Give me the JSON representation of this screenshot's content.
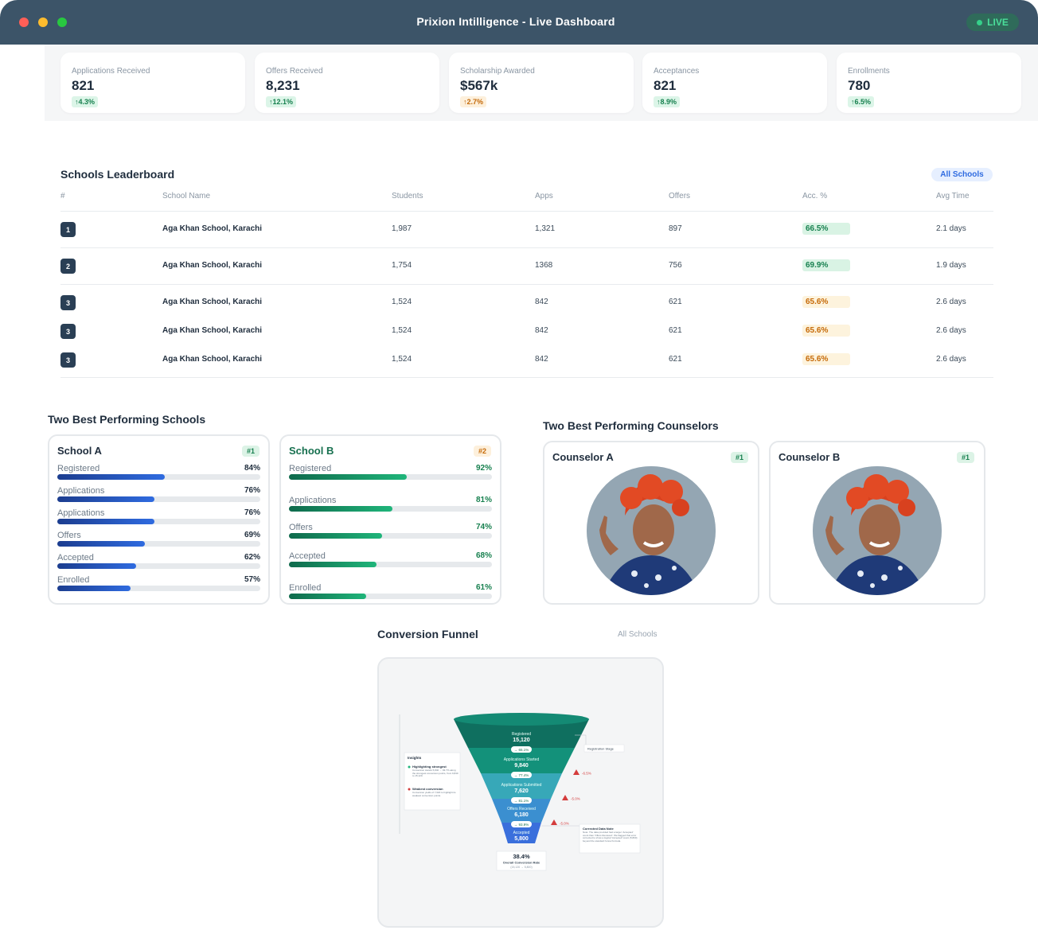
{
  "window": {
    "title": "Prixion Intilligence - Live Dashboard",
    "live_label": "LIVE"
  },
  "kpis": [
    {
      "label": "Applications Received",
      "value": "821",
      "change": "↑4.3%",
      "tone": "up"
    },
    {
      "label": "Offers Received",
      "value": "8,231",
      "change": "↑12.1%",
      "tone": "up"
    },
    {
      "label": "Scholarship Awarded",
      "value": "$567k",
      "change": "↑2.7%",
      "tone": "warn"
    },
    {
      "label": "Acceptances",
      "value": "821",
      "change": "↑8.9%",
      "tone": "up"
    },
    {
      "label": "Enrollments",
      "value": "780",
      "change": "↑6.5%",
      "tone": "up"
    }
  ],
  "leaderboard": {
    "title": "Schools Leaderboard",
    "filter_label": "All Schools",
    "columns": [
      "#",
      "School Name",
      "Students",
      "Apps",
      "Offers",
      "Acc. %",
      "Avg Time"
    ],
    "rows": [
      {
        "rank": "1",
        "name": "Aga Khan School, Karachi",
        "students": "1,987",
        "apps": "1,321",
        "offers": "897",
        "acc": "66.5%",
        "acc_tone": "good",
        "time": "2.1 days"
      },
      {
        "rank": "2",
        "name": "Aga Khan School, Karachi",
        "students": "1,754",
        "apps": "1368",
        "offers": "756",
        "acc": "69.9%",
        "acc_tone": "good",
        "time": "1.9 days"
      },
      {
        "rank": "3",
        "name": "Aga Khan School, Karachi",
        "students": "1,524",
        "apps": "842",
        "offers": "621",
        "acc": "65.6%",
        "acc_tone": "mid",
        "time": "2.6 days"
      },
      {
        "rank": "3",
        "name": "Aga Khan School, Karachi",
        "students": "1,524",
        "apps": "842",
        "offers": "621",
        "acc": "65.6%",
        "acc_tone": "mid",
        "time": "2.6 days"
      },
      {
        "rank": "3",
        "name": "Aga Khan School, Karachi",
        "students": "1,524",
        "apps": "842",
        "offers": "621",
        "acc": "65.6%",
        "acc_tone": "mid",
        "time": "2.6 days"
      }
    ]
  },
  "best_schools": {
    "title": "Two Best Performing Schools",
    "cards": [
      {
        "name": "School A",
        "badge": "#1",
        "metrics": [
          {
            "label": "Registered",
            "value": "84%",
            "fraction": 0.53
          },
          {
            "label": "Applications",
            "value": "76%",
            "fraction": 0.48
          },
          {
            "label": "Applications",
            "value": "76%",
            "fraction": 0.48
          },
          {
            "label": "Offers",
            "value": "69%",
            "fraction": 0.43
          },
          {
            "label": "Accepted",
            "value": "62%",
            "fraction": 0.39
          },
          {
            "label": "Enrolled",
            "value": "57%",
            "fraction": 0.36
          }
        ]
      },
      {
        "name": "School B",
        "badge": "#2",
        "metrics": [
          {
            "label": "Registered",
            "value": "92%",
            "fraction": 0.58
          },
          {
            "label": "Applications",
            "value": "81%",
            "fraction": 0.51
          },
          {
            "label": "Offers",
            "value": "74%",
            "fraction": 0.46
          },
          {
            "label": "Accepted",
            "value": "68%",
            "fraction": 0.43
          },
          {
            "label": "Enrolled",
            "value": "61%",
            "fraction": 0.38
          }
        ]
      }
    ]
  },
  "best_counselors": {
    "title": "Two Best Performing Counselors",
    "cards": [
      {
        "name": "Counselor A",
        "badge": "#1"
      },
      {
        "name": "Counselor B",
        "badge": "#1"
      }
    ]
  },
  "funnel": {
    "title": "Conversion Funnel",
    "filter_label": "All Schools",
    "stages": [
      {
        "label": "Registered",
        "value": "15,120"
      },
      {
        "label": "Applications Started",
        "value": "9,840"
      },
      {
        "label": "Applications Submitted",
        "value": "7,620"
      },
      {
        "label": "Offers Received",
        "value": "6,180"
      },
      {
        "label": "Accepted",
        "value": "5,800"
      }
    ],
    "rates": [
      "→ 65.1%",
      "→ 77.4%",
      "→ 81.1%",
      "→ 93.9%"
    ],
    "drops": [
      "-6.5%",
      "-5.0%",
      "-5.0%"
    ],
    "stage_note": "Registration Stage",
    "overall": {
      "value": "38.4%",
      "label": "Overall Conversion Rate",
      "sub": "(15,120 → 5,800)"
    },
    "insights": {
      "title": "Insights",
      "strong_title": "Highlighting strongest",
      "strong_text": "Conversion stands 5,840 → 93.7% along the strongest conversion points, from 9,840 to 15,120.",
      "weak_title": "Weakest conversion",
      "weak_text": "Conversion yields of 7,620 to highlight its weakest conversion points."
    },
    "note": {
      "title": "Corrected Data Note",
      "text": "Note: The data provided had a larger 'Accepted' count than 'Offers Received'. We flagged that error corrected to show a logical 'Accepted' count (5,800) beyond the standard funnel formula."
    }
  },
  "colors": {
    "titlebar": "#3c5468",
    "accent_blue": "#2f6be0",
    "accent_green": "#1fb57a",
    "funnel_teal": "#0f7a68"
  }
}
